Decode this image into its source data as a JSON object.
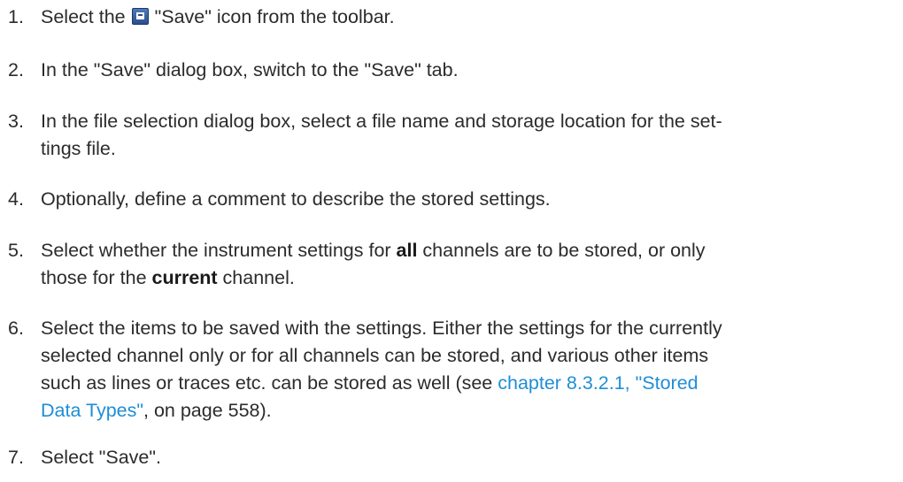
{
  "steps": [
    {
      "num": "1.",
      "before": "Select the",
      "icon": "save-icon",
      "after": "\"Save\" icon from the toolbar."
    },
    {
      "num": "2.",
      "text": "In the \"Save\" dialog box, switch to the \"Save\" tab."
    },
    {
      "num": "3.",
      "line1": "In the file selection dialog box, select a file name and storage location for the set-",
      "line2": "tings file."
    },
    {
      "num": "4.",
      "text": "Optionally, define a comment to describe the stored settings."
    },
    {
      "num": "5.",
      "l1a": "Select whether the instrument settings for ",
      "l1b": "all",
      "l1c": " channels are to be stored, or only",
      "l2a": "those for the ",
      "l2b": "current",
      "l2c": " channel."
    },
    {
      "num": "6.",
      "line1": "Select the items to be saved with the settings. Either the settings for the currently",
      "line2": "selected channel only or for all channels can be stored, and various other items",
      "line3a": "such as lines or traces etc. can be stored as well (see ",
      "link_a": "chapter 8.3.2.1, \"Stored",
      "link_b": "Data Types\"",
      "line4b": ", on page 558)."
    },
    {
      "num": "7.",
      "text": "Select \"Save\"."
    }
  ],
  "colors": {
    "text": "#2b2b2b",
    "link": "#1e8ed6",
    "icon": "#2a4f8c"
  }
}
